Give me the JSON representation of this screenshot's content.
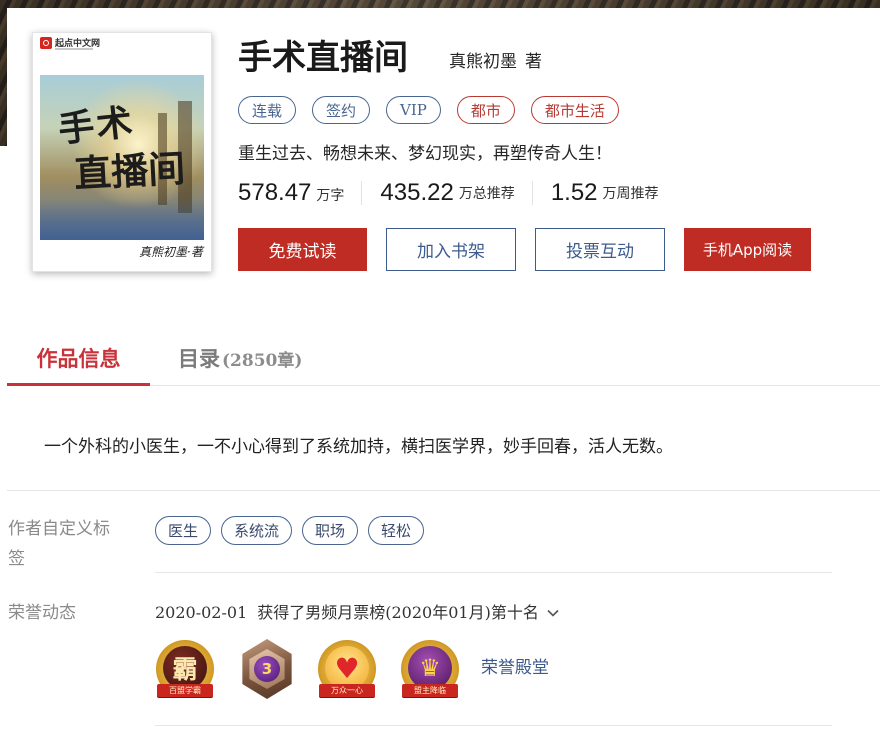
{
  "cover": {
    "logo_icon": "qidian-logo-icon",
    "logo_text": "起点中文网",
    "art_line1": "手术",
    "art_line2": "直播间",
    "signature": "真熊初墨·著"
  },
  "book": {
    "title": "手术直播间",
    "author": "真熊初墨",
    "author_suffix": "著",
    "tags": [
      {
        "label": "连载",
        "color": "#4a6590"
      },
      {
        "label": "签约",
        "color": "#4a6590"
      },
      {
        "label": "VIP",
        "color": "#4a6590"
      },
      {
        "label": "都市",
        "color": "#b83a33"
      },
      {
        "label": "都市生活",
        "color": "#b83a33"
      }
    ],
    "intro": "重生过去、畅想未来、梦幻现实，再塑传奇人生！",
    "stats": [
      {
        "value": "578.47",
        "unit": "万字"
      },
      {
        "value": "435.22",
        "unit": "万总推荐"
      },
      {
        "value": "1.52",
        "unit": "万周推荐"
      }
    ],
    "actions": {
      "free_read": "免费试读",
      "add_shelf": "加入书架",
      "vote": "投票互动",
      "app_read": "手机App阅读"
    }
  },
  "tabs": [
    {
      "label": "作品信息",
      "active": true
    },
    {
      "label": "目录",
      "count": "(2850章)",
      "active": false
    }
  ],
  "description": "一个外科的小医生，一不小心得到了系统加持，横扫医学界，妙手回春，活人无数。",
  "custom_tags": {
    "label": "作者自定义标签",
    "items": [
      "医生",
      "系统流",
      "职场",
      "轻松"
    ]
  },
  "honors": {
    "label": "荣誉动态",
    "latest_date": "2020-02-01",
    "latest_text": "获得了男频月票榜(2020年01月)第十名",
    "expand_icon": "chevron-down-icon",
    "badges": [
      {
        "icon": "xueba-badge-icon",
        "glyph": "霸",
        "ribbon": "百盟学霸"
      },
      {
        "icon": "level-badge-icon",
        "glyph": "3"
      },
      {
        "icon": "heart-badge-icon",
        "ribbon": "万众一心"
      },
      {
        "icon": "crown-badge-icon",
        "ribbon": "盟主降临"
      }
    ],
    "hall_link": "荣誉殿堂"
  },
  "colors": {
    "accent_red": "#bf2c24",
    "tab_red": "#c9323a",
    "link_blue": "#3d5b8c",
    "label_gray": "#8a8a8a"
  }
}
